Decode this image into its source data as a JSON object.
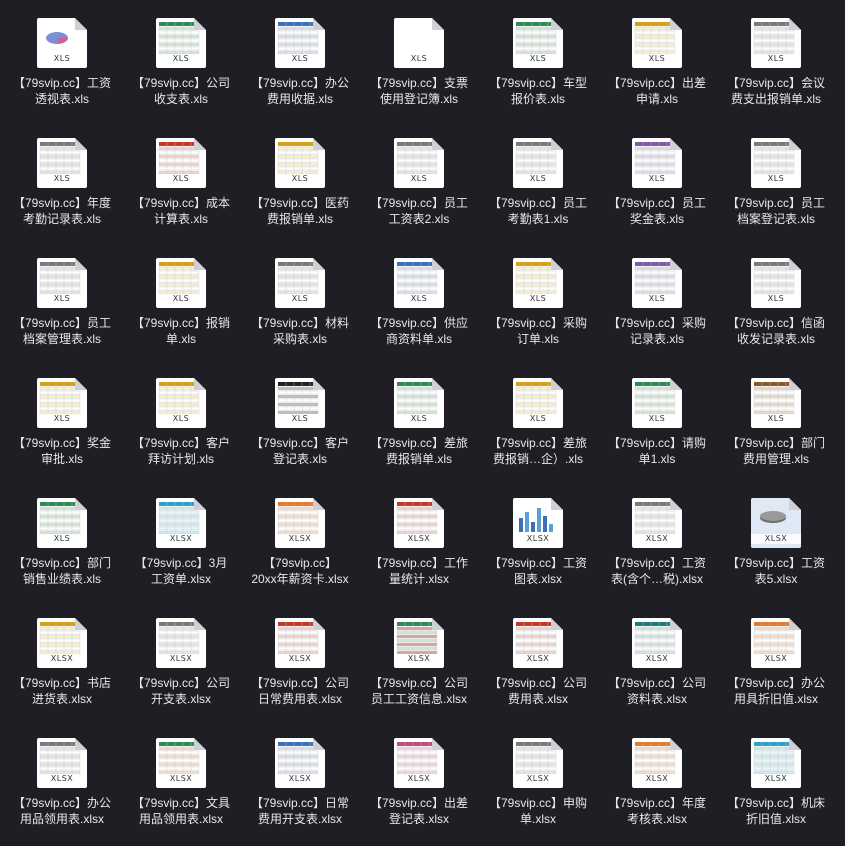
{
  "accent_colors": [
    "#2e8b57",
    "#3b6fb6",
    "#c0392b",
    "#d4a017",
    "#7a7a7a"
  ],
  "files": [
    {
      "name": "【79svip.cc】工资\n透视表.xls",
      "ext": "XLS",
      "thumb": "pie"
    },
    {
      "name": "【79svip.cc】公司\n收支表.xls",
      "ext": "XLS",
      "thumb": "green"
    },
    {
      "name": "【79svip.cc】办公\n费用收据.xls",
      "ext": "XLS",
      "thumb": "blue"
    },
    {
      "name": "【79svip.cc】支票\n使用登记簿.xls",
      "ext": "XLS",
      "thumb": "blank"
    },
    {
      "name": "【79svip.cc】车型\n报价表.xls",
      "ext": "XLS",
      "thumb": "green"
    },
    {
      "name": "【79svip.cc】出差\n申请.xls",
      "ext": "XLS",
      "thumb": "yellow"
    },
    {
      "name": "【79svip.cc】会议\n费支出报销单.xls",
      "ext": "XLS",
      "thumb": "gray"
    },
    {
      "name": "【79svip.cc】年度\n考勤记录表.xls",
      "ext": "XLS",
      "thumb": "gray"
    },
    {
      "name": "【79svip.cc】成本\n计算表.xls",
      "ext": "XLS",
      "thumb": "red"
    },
    {
      "name": "【79svip.cc】医药\n费报销单.xls",
      "ext": "XLS",
      "thumb": "yellow"
    },
    {
      "name": "【79svip.cc】员工\n工资表2.xls",
      "ext": "XLS",
      "thumb": "gray"
    },
    {
      "name": "【79svip.cc】员工\n考勤表1.xls",
      "ext": "XLS",
      "thumb": "gray"
    },
    {
      "name": "【79svip.cc】员工\n奖金表.xls",
      "ext": "XLS",
      "thumb": "purple"
    },
    {
      "name": "【79svip.cc】员工\n档案登记表.xls",
      "ext": "XLS",
      "thumb": "gray"
    },
    {
      "name": "【79svip.cc】员工\n档案管理表.xls",
      "ext": "XLS",
      "thumb": "gray"
    },
    {
      "name": "【79svip.cc】报销\n单.xls",
      "ext": "XLS",
      "thumb": "yellow"
    },
    {
      "name": "【79svip.cc】材料\n采购表.xls",
      "ext": "XLS",
      "thumb": "gray"
    },
    {
      "name": "【79svip.cc】供应\n商资料单.xls",
      "ext": "XLS",
      "thumb": "blue"
    },
    {
      "name": "【79svip.cc】采购\n订单.xls",
      "ext": "XLS",
      "thumb": "yellow"
    },
    {
      "name": "【79svip.cc】采购\n记录表.xls",
      "ext": "XLS",
      "thumb": "purple"
    },
    {
      "name": "【79svip.cc】信函\n收发记录表.xls",
      "ext": "XLS",
      "thumb": "gray"
    },
    {
      "name": "【79svip.cc】奖金\n审批.xls",
      "ext": "XLS",
      "thumb": "yellow"
    },
    {
      "name": "【79svip.cc】客户\n拜访计划.xls",
      "ext": "XLS",
      "thumb": "yellow"
    },
    {
      "name": "【79svip.cc】客户\n登记表.xls",
      "ext": "XLS",
      "thumb": "dark"
    },
    {
      "name": "【79svip.cc】差旅\n费报销单.xls",
      "ext": "XLS",
      "thumb": "green"
    },
    {
      "name": "【79svip.cc】差旅\n费报销…企）.xls",
      "ext": "XLS",
      "thumb": "yellow"
    },
    {
      "name": "【79svip.cc】请购\n单1.xls",
      "ext": "XLS",
      "thumb": "green"
    },
    {
      "name": "【79svip.cc】部门\n费用管理.xls",
      "ext": "XLS",
      "thumb": "brown"
    },
    {
      "name": "【79svip.cc】部门\n销售业绩表.xls",
      "ext": "XLS",
      "thumb": "green"
    },
    {
      "name": "【79svip.cc】3月\n工资单.xlsx",
      "ext": "XLSX",
      "thumb": "cyan"
    },
    {
      "name": "【79svip.cc】\n20xx年薪资卡.xlsx",
      "ext": "XLSX",
      "thumb": "orange"
    },
    {
      "name": "【79svip.cc】工作\n量统计.xlsx",
      "ext": "XLSX",
      "thumb": "red"
    },
    {
      "name": "【79svip.cc】工资\n图表.xlsx",
      "ext": "XLSX",
      "thumb": "bars"
    },
    {
      "name": "【79svip.cc】工资\n表(含个…税).xlsx",
      "ext": "XLSX",
      "thumb": "gray"
    },
    {
      "name": "【79svip.cc】工资\n表5.xlsx",
      "ext": "XLSX",
      "thumb": "disk"
    },
    {
      "name": "【79svip.cc】书店\n进货表.xlsx",
      "ext": "XLSX",
      "thumb": "yellow"
    },
    {
      "name": "【79svip.cc】公司\n开支表.xlsx",
      "ext": "XLSX",
      "thumb": "gray"
    },
    {
      "name": "【79svip.cc】公司\n日常费用表.xlsx",
      "ext": "XLSX",
      "thumb": "red"
    },
    {
      "name": "【79svip.cc】公司\n员工工资信息.xlsx",
      "ext": "XLSX",
      "thumb": "greenred"
    },
    {
      "name": "【79svip.cc】公司\n费用表.xlsx",
      "ext": "XLSX",
      "thumb": "red"
    },
    {
      "name": "【79svip.cc】公司\n资料表.xlsx",
      "ext": "XLSX",
      "thumb": "teal"
    },
    {
      "name": "【79svip.cc】办公\n用具折旧值.xlsx",
      "ext": "XLSX",
      "thumb": "orange"
    },
    {
      "name": "【79svip.cc】办公\n用品领用表.xlsx",
      "ext": "XLSX",
      "thumb": "gray"
    },
    {
      "name": "【79svip.cc】文具\n用品领用表.xlsx",
      "ext": "XLSX",
      "thumb": "greenorange"
    },
    {
      "name": "【79svip.cc】日常\n费用开支表.xlsx",
      "ext": "XLSX",
      "thumb": "blue"
    },
    {
      "name": "【79svip.cc】出差\n登记表.xlsx",
      "ext": "XLSX",
      "thumb": "pink"
    },
    {
      "name": "【79svip.cc】申购\n单.xlsx",
      "ext": "XLSX",
      "thumb": "gray"
    },
    {
      "name": "【79svip.cc】年度\n考核表.xlsx",
      "ext": "XLSX",
      "thumb": "orange"
    },
    {
      "name": "【79svip.cc】机床\n折旧值.xlsx",
      "ext": "XLSX",
      "thumb": "cyan"
    }
  ]
}
